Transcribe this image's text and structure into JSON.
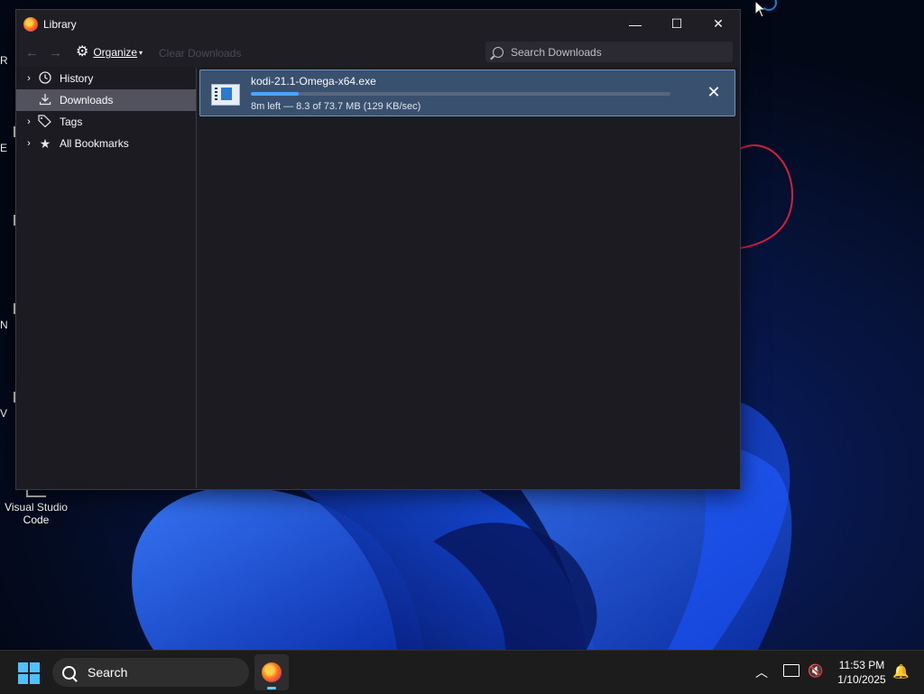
{
  "window": {
    "title": "Library",
    "minimize": "—",
    "maximize": "☐",
    "close": "✕"
  },
  "toolbar": {
    "back": "←",
    "forward": "→",
    "organize_label": "Organize",
    "organize_caret": "▾",
    "clear_label": "Clear Downloads",
    "search_placeholder": "Search Downloads"
  },
  "sidebar": {
    "items": [
      {
        "label": "History",
        "expandable": true,
        "icon": "clock-icon"
      },
      {
        "label": "Downloads",
        "expandable": false,
        "icon": "download-icon",
        "selected": true
      },
      {
        "label": "Tags",
        "expandable": true,
        "icon": "tag-icon"
      },
      {
        "label": "All Bookmarks",
        "expandable": true,
        "icon": "star-icon"
      }
    ]
  },
  "downloads": [
    {
      "file_name": "kodi-21.1-Omega-x64.exe",
      "progress_fraction": 0.113,
      "status": "8m left — 8.3 of 73.7 MB (129 KB/sec)"
    }
  ],
  "desktop": {
    "vscode_label": "Visual Studio Code",
    "fragments": [
      "R",
      "E",
      "N",
      "V"
    ]
  },
  "taskbar": {
    "search_label": "Search",
    "time": "11:53 PM",
    "date": "1/10/2025"
  },
  "colors": {
    "accent": "#4ba4ff",
    "selected_row": "#39506e",
    "window_bg": "#1c1b22"
  }
}
